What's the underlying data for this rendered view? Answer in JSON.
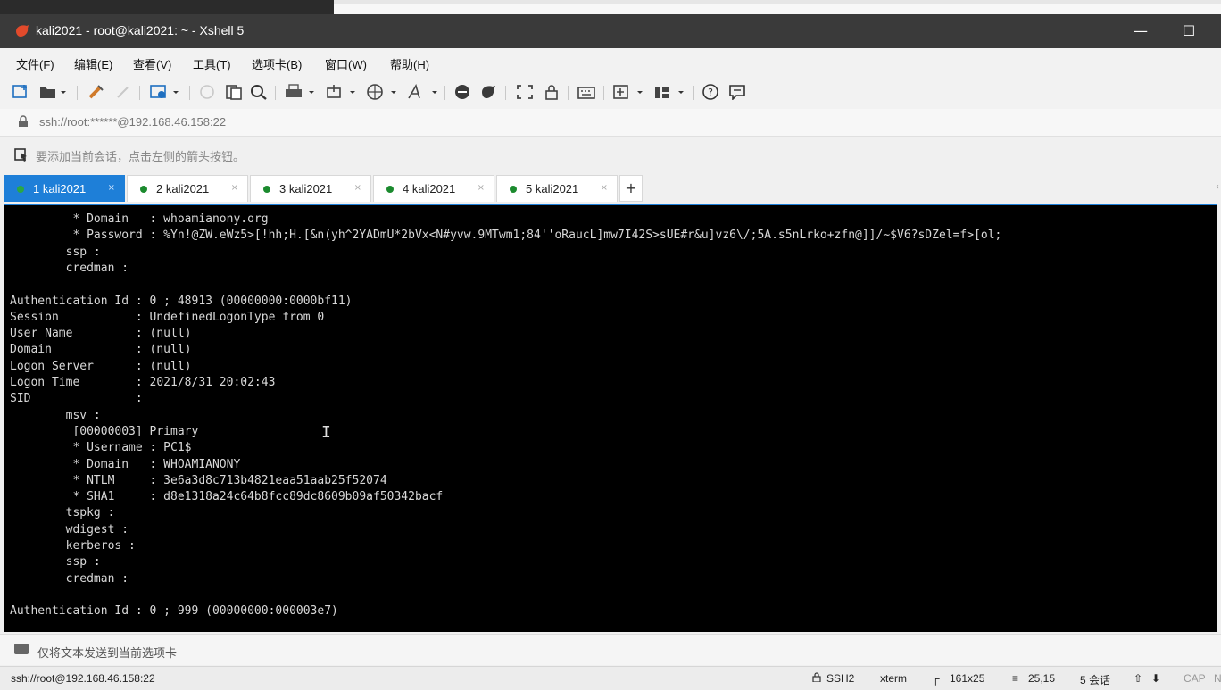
{
  "window": {
    "title": "kali2021 - root@kali2021: ~ - Xshell 5",
    "minimize": "—",
    "maximize": "☐"
  },
  "menu": [
    "文件(F)",
    "编辑(E)",
    "查看(V)",
    "工具(T)",
    "选项卡(B)",
    "窗口(W)",
    "帮助(H)"
  ],
  "address": {
    "text": "ssh://root:******@192.168.46.158:22"
  },
  "hint": {
    "text": "要添加当前会话，点击左侧的箭头按钮。"
  },
  "tabs": [
    {
      "label": "1 kali2021",
      "active": true
    },
    {
      "label": "2 kali2021",
      "active": false
    },
    {
      "label": "3 kali2021",
      "active": false
    },
    {
      "label": "4 kali2021",
      "active": false
    },
    {
      "label": "5 kali2021",
      "active": false
    }
  ],
  "tab_close": "×",
  "tab_add": "+",
  "terminal": {
    "lines": [
      "         * Domain   : whoamianony.org",
      "         * Password : %Yn!@ZW.eWz5>[!hh;H.[&n(yh^2YADmU*2bVx<N#yvw.9MTwm1;84''oRaucL]mw7I42S>sUE#r&u]vz6\\/;5A.s5nLrko+zfn@]]/~$V6?sDZel=f>[ol;",
      "        ssp :",
      "        credman :",
      "",
      "Authentication Id : 0 ; 48913 (00000000:0000bf11)",
      "Session           : UndefinedLogonType from 0",
      "User Name         : (null)",
      "Domain            : (null)",
      "Logon Server      : (null)",
      "Logon Time        : 2021/8/31 20:02:43",
      "SID               :",
      "        msv :",
      "         [00000003] Primary",
      "         * Username : PC1$",
      "         * Domain   : WHOAMIANONY",
      "         * NTLM     : 3e6a3d8c713b4821eaa51aab25f52074",
      "         * SHA1     : d8e1318a24c64b8fcc89dc8609b09af50342bacf",
      "        tspkg :",
      "        wdigest :",
      "        kerberos :",
      "        ssp :",
      "        credman :",
      "",
      "Authentication Id : 0 ; 999 (00000000:000003e7)"
    ]
  },
  "sendbar": {
    "text": "仅将文本发送到当前选项卡"
  },
  "status": {
    "connection": "ssh://root@192.168.46.158:22",
    "protocol": "SSH2",
    "term": "xterm",
    "size": "161x25",
    "cursor": "25,15",
    "sessions": "5 会话",
    "caps": "CAP",
    "num": "NUM"
  }
}
